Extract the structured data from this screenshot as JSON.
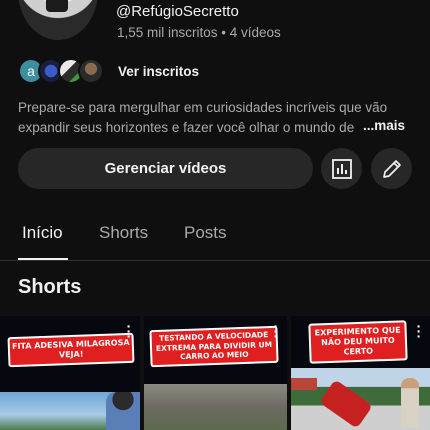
{
  "channel": {
    "handle": "@RefúgioSecretto",
    "meta": "1,55 mil inscritos • 4 vídeos",
    "subscribers_label": "Ver inscritos",
    "subscriber_avatars": [
      {
        "letter": "a"
      },
      {
        "letter": ""
      },
      {
        "letter": ""
      },
      {
        "letter": ""
      }
    ],
    "description": "Prepare-se para mergulhar em curiosidades incríveis que vão expandir seus horizontes e fazer você olhar o mundo de",
    "more_label": "...mais"
  },
  "actions": {
    "manage_label": "Gerenciar vídeos",
    "stats_icon": "bar-chart-icon",
    "edit_icon": "pencil-icon"
  },
  "tabs": [
    {
      "label": "Início",
      "active": true
    },
    {
      "label": "Shorts",
      "active": false
    },
    {
      "label": "Posts",
      "active": false
    }
  ],
  "shorts_section": {
    "title": "Shorts",
    "items": [
      {
        "caption": "FITA ADESIVA MILAGROSA VEJA!"
      },
      {
        "caption": "TESTANDO A VELOCIDADE EXTREMA PARA DIVIDIR UM CARRO AO MEIO"
      },
      {
        "caption": "EXPERIMENTO QUE NÃO DEU MUITO CERTO"
      }
    ]
  },
  "colors": {
    "background": "#0f0f0f",
    "button": "#272727",
    "caption_red": "#e02020",
    "secondary_text": "#aaaaaa"
  }
}
